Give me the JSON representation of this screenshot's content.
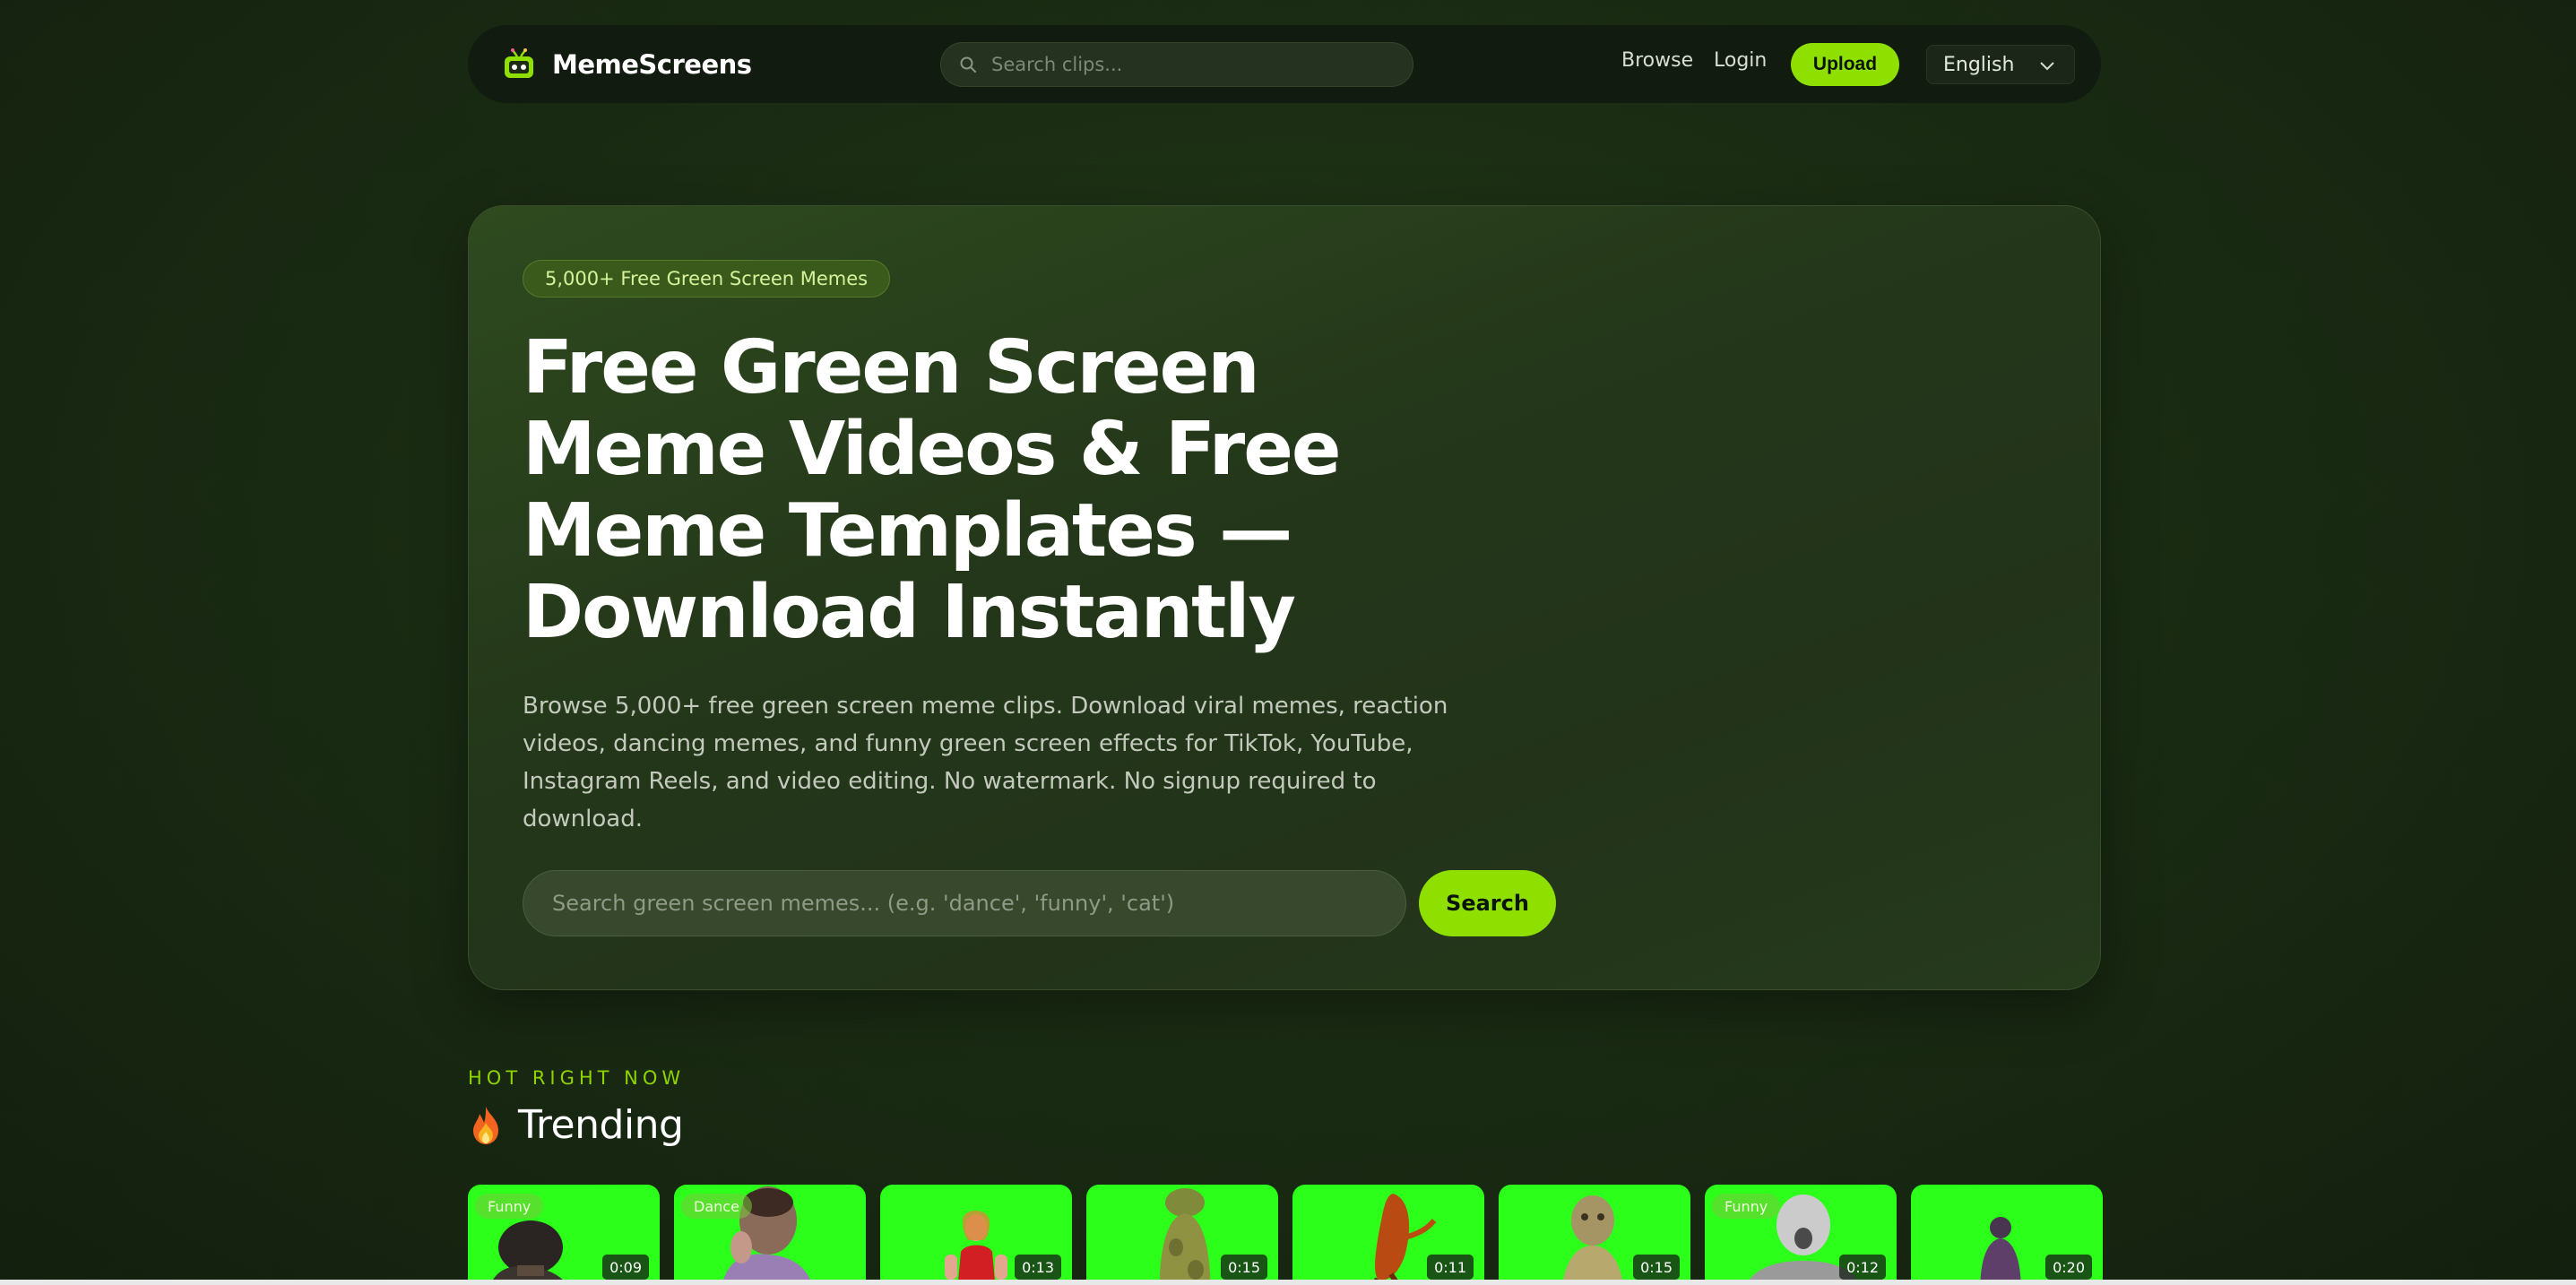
{
  "navbar": {
    "logo_text": "MemeScreens",
    "search_placeholder": "Search clips...",
    "browse_label": "Browse",
    "login_label": "Login",
    "upload_label": "Upload",
    "language_selected": "English"
  },
  "hero": {
    "badge": "5,000+ Free Green Screen Memes",
    "title": "Free Green Screen Meme Videos & Free Meme Templates — Download Instantly",
    "description": "Browse 5,000+ free green screen meme clips. Download viral memes, reaction videos, dancing memes, and funny green screen effects for TikTok, YouTube, Instagram Reels, and video editing. No watermark. No signup required to download.",
    "search_placeholder": "Search green screen memes... (e.g. 'dance', 'funny', 'cat')",
    "search_button": "Search"
  },
  "trending": {
    "eyebrow": "HOT RIGHT NOW",
    "title": "Trending",
    "clips": [
      {
        "tag": "Funny",
        "duration": "0:09"
      },
      {
        "tag": "Dance",
        "duration": ""
      },
      {
        "tag": "",
        "duration": "0:13"
      },
      {
        "tag": "",
        "duration": "0:15"
      },
      {
        "tag": "",
        "duration": "0:11"
      },
      {
        "tag": "",
        "duration": "0:15"
      },
      {
        "tag": "Funny",
        "duration": "0:12"
      },
      {
        "tag": "",
        "duration": "0:20"
      }
    ]
  },
  "colors": {
    "accent": "#8fe000",
    "green_screen": "#2bff1a",
    "background": "#1a2c13"
  },
  "icons": {
    "logo": "tv-robot-icon",
    "search": "search-icon",
    "chevron": "chevron-down-icon",
    "fire": "fire-icon"
  }
}
